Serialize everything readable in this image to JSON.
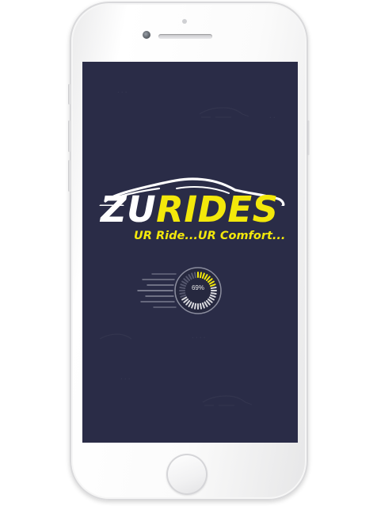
{
  "app": {
    "logo_part1": "ZU",
    "logo_part2": "RIDES",
    "tagline": "UR Ride...UR Comfort..."
  },
  "loader": {
    "progress_percent": 69,
    "label": "69%"
  },
  "colors": {
    "screen_background": "#2a2c47",
    "brand_yellow": "#f3e80b",
    "logo_white": "#ffffff",
    "loader_track": "#55576e",
    "loader_ring": "#8c8e9f",
    "speed_lines": "#9b9dae"
  },
  "device": {
    "type": "smartphone",
    "color": "white"
  }
}
